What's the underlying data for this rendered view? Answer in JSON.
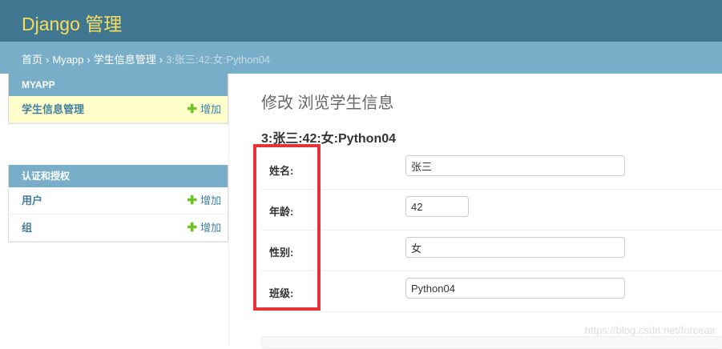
{
  "header": {
    "branding": "Django 管理"
  },
  "breadcrumbs": {
    "home": "首页",
    "app": "Myapp",
    "model": "学生信息管理",
    "current": "3:张三:42:女:Python04",
    "separator": "›"
  },
  "sidebar": {
    "modules": [
      {
        "caption": "MYAPP",
        "rows": [
          {
            "name": "学生信息管理",
            "add": "增加"
          }
        ]
      },
      {
        "caption": "认证和授权",
        "rows": [
          {
            "name": "用户",
            "add": "增加"
          },
          {
            "name": "组",
            "add": "增加"
          }
        ]
      }
    ],
    "add_symbol": "✚"
  },
  "content": {
    "page_title": "修改 浏览学生信息",
    "object_title": "3:张三:42:女:Python04",
    "fields": [
      {
        "label": "姓名:",
        "value": "张三"
      },
      {
        "label": "年龄:",
        "value": "42"
      },
      {
        "label": "性别:",
        "value": "女"
      },
      {
        "label": "班级:",
        "value": "Python04"
      }
    ]
  },
  "watermark": "https://blog.csdn.net/forceair",
  "colors": {
    "header_bg": "#417690",
    "branding": "#f5dd5d",
    "breadcrumb_bg": "#79aec8",
    "highlight": "#e8323a",
    "add_plus": "#70bf2b"
  }
}
